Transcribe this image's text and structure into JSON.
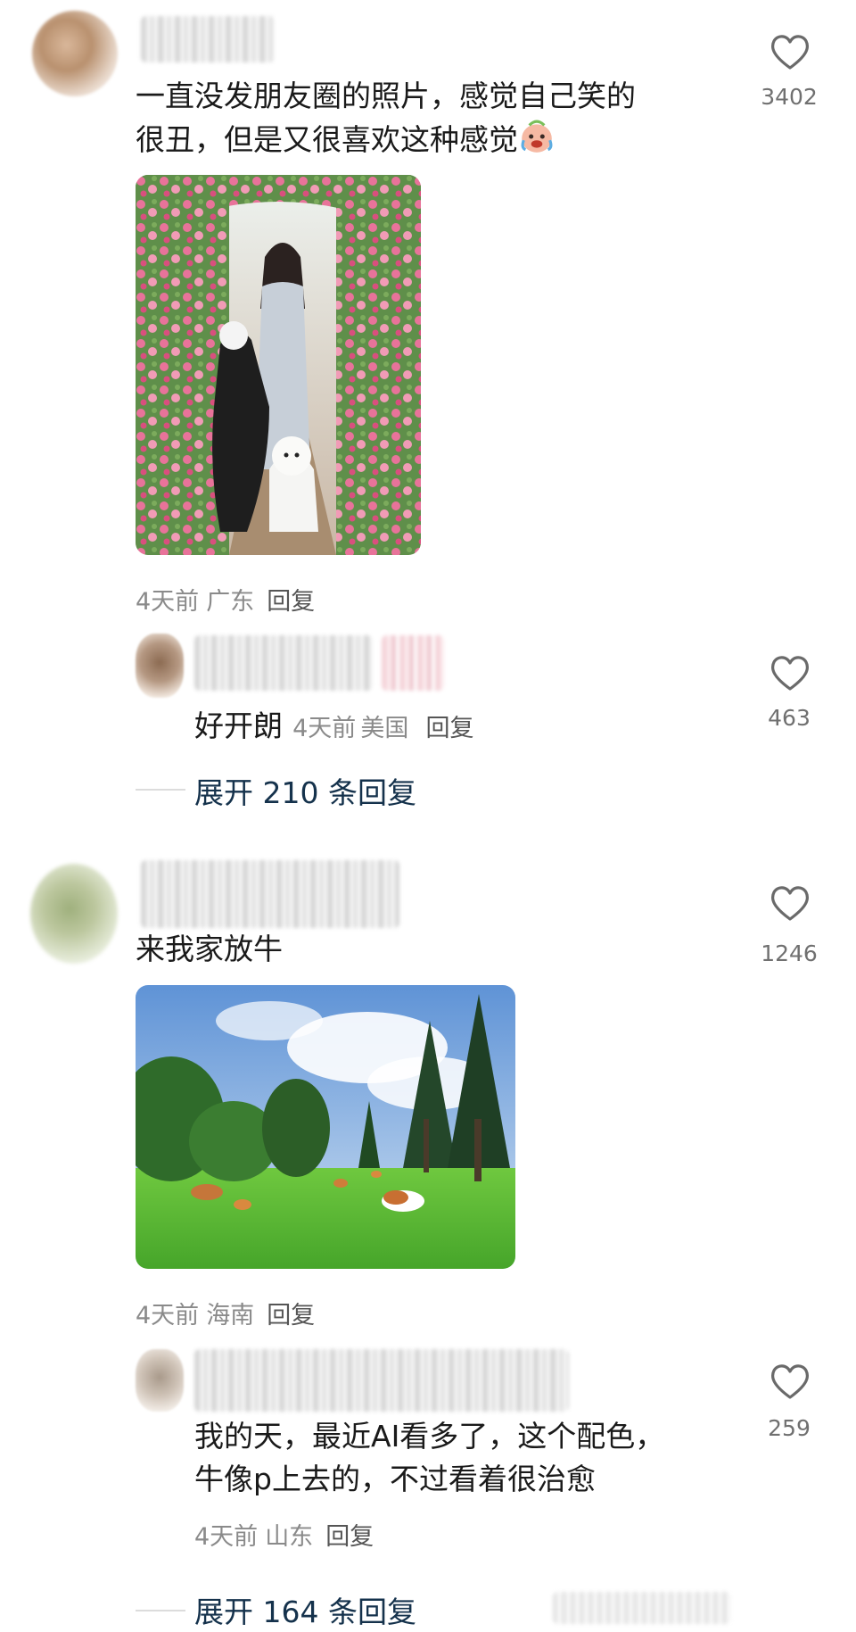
{
  "comments": [
    {
      "text_line1": "一直没发朋友圈的照片，感觉自己笑的",
      "text_line2": "很丑，但是又很喜欢这种感觉",
      "emoji": "crying-laughing-face",
      "like_count": "3402",
      "meta": {
        "time": "4天前",
        "location": "广东",
        "reply": "回复"
      },
      "reply": {
        "text": "好开朗",
        "time": "4天前",
        "location": "美国",
        "reply_label": "回复",
        "like_count": "463"
      },
      "expand_label": "展开 210 条回复"
    },
    {
      "text": "来我家放牛",
      "like_count": "1246",
      "meta": {
        "time": "4天前",
        "location": "海南",
        "reply": "回复"
      },
      "reply": {
        "text_line1": "我的天，最近AI看多了，这个配色，",
        "text_line2": "牛像p上去的，不过看着很治愈",
        "time": "4天前",
        "location": "山东",
        "reply_label": "回复",
        "like_count": "259"
      },
      "expand_label": "展开 164 条回复"
    }
  ],
  "icons": {
    "like": "heart-icon",
    "photo1": "rose-garden-photo",
    "photo2": "pasture-cows-photo"
  }
}
